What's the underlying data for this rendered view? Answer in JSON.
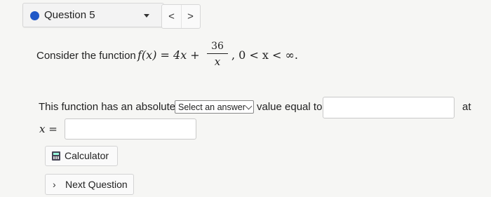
{
  "question_nav": {
    "question_label": "Question 5",
    "prev_glyph": "<",
    "next_glyph": ">"
  },
  "problem": {
    "prompt_text": "Consider the function",
    "function_lhs": "f(x) = 4x +",
    "fraction_numerator": "36",
    "fraction_denominator": "x",
    "domain_text": ",   0 < x < ∞."
  },
  "answer_line": {
    "prefix_text": "This function has an absolute",
    "select_value": "Select an answer",
    "middle_text": "value equal to",
    "value_input": "",
    "suffix_text": "at",
    "x_label": "x =",
    "x_input": ""
  },
  "buttons": {
    "calculator_label": "Calculator",
    "next_question_label": "Next Question"
  },
  "colors": {
    "question_dot": "#1e57c7",
    "page_background": "#f6f6f4"
  }
}
